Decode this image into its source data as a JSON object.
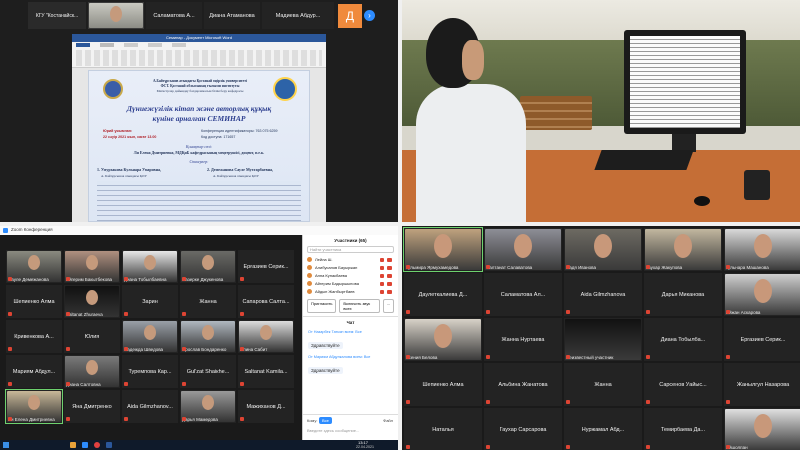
{
  "q1": {
    "tiles": [
      "КГУ \"Костанайск...",
      "Саламатова А...",
      "Диана Атаманова",
      "Мадиева Абдур...",
      "Д"
    ],
    "doc": {
      "ribbon_title": "Семинар - Документ Microsoft Word",
      "header_line1": "А.Байтұрсынов атындағы Қостанай өңірлік университеті",
      "header_line2": "ФСТ. Қостанай облысының ғылыми институты",
      "header_line3": "Магистрлар дайындау бағдарламасын білім беру кафедрасы",
      "title_line1": "Дүниежүзілік кітап және авторлық құқық",
      "title_line2": "күніне арналған СЕМИНАР",
      "meta_left1": "Юрий ұжымнан:",
      "meta_left2": "22 сәуір 2021 жыл, сағат 13.00",
      "meta_right1": "Конференция идентификаторы: 763 075 6259",
      "meta_right2": "Код доступа: 171657",
      "guest_heading": "Қонақтар сөзі:",
      "guest_name": "Ли Елена Дмитриевна, МДҚиБ кафедрасының меңгерушісі, доцент, п.ғ.к.",
      "speakers_heading": "Спикерлер:",
      "speaker1": "1. Умурзакова Кульнара Умаровна,",
      "speaker1_role": "А. Байтұрсынов атындағы ҚӨУ",
      "speaker2": "2. Демежанова Сауле Мухтарбаевна,",
      "speaker2_role": "А. Байтұрсынов атындағы ҚӨУ"
    }
  },
  "q3": {
    "title": "Zoom Конференция",
    "tiles": [
      [
        "Сауле Демежанова",
        "Айгерим Бакытбекова",
        "Диана Тобылбаевна",
        "Назерке Джукенова",
        "Ерғазиев Серик..."
      ],
      [
        "Шепиенко Алма",
        "Saltanat Zhuraeva",
        "Зарин",
        "Жанна",
        "Сапарова Салта..."
      ],
      [
        "Кривенкова А...",
        "Юлия",
        "Надежда Шведова",
        "Ярослав Бондаренко",
        "Алина Сабит"
      ],
      [
        "Мариям Абдул...",
        "Диана Салтовна",
        "Туремпова Кар...",
        "Gul'zat Shaiкhe...",
        "Saltanat Kamila..."
      ],
      [
        "Ли Елена Дмитриевна",
        "Яна Дмитренко",
        "Aida Gilmzhanov...",
        "Дарья Мамедова",
        "Мажиханов Д..."
      ]
    ],
    "participants_title": "Участники (65)",
    "search_placeholder": "Найти участника",
    "participants": [
      "Лейла Ш.",
      "Алибусанов Бауыржан",
      "Анна Кунакбаева",
      "Айгерим Бадыршынова",
      "Айдын Жанбыртбаев"
    ],
    "invite_label": "Пригласить",
    "mute_all_label": "Включить звук всех",
    "more_label": "...",
    "chat_title": "Чат",
    "chat_messages": [
      {
        "from": "От Назарбек Татьян всем: Все",
        "text": "Здравствуйте"
      },
      {
        "from": "От Мариям Абдулкалова всем: Все",
        "text": "Здравствуйте"
      }
    ],
    "chat_to_label": "Кому:",
    "chat_to_value": "Все",
    "chat_file_label": "Файл",
    "chat_input_placeholder": "Введите здесь сообщение...",
    "time": "13:17",
    "date": "22.04.2021"
  },
  "q4": {
    "tiles": [
      [
        "Гульмира Ярмухамедова",
        "Салтанат Салаватова",
        "Надя Иванова",
        "Гаухар Жакупова",
        "Гульнара Машанова"
      ],
      [
        "Даулеткалиева Д...",
        "Саламатова Ал...",
        "Aida Gilmzhanova",
        "Дарья Миканова",
        "Айжан Аскарова"
      ],
      [
        "Ксения Белова",
        "Жанна Нуртаева",
        "Неизвестный участник",
        "Диана Тобылба...",
        "Ергазиев Серик..."
      ],
      [
        "Шепиенко Алма",
        "Альбина Жанатова",
        "Жанна",
        "Сарсенов Уайыс...",
        "Жанылгул Назарова"
      ],
      [
        "Наталья",
        "Гаухар Сарсарова",
        "Нуржамал Абд...",
        "Темирбаева Да...",
        "Айшолпан"
      ]
    ]
  }
}
